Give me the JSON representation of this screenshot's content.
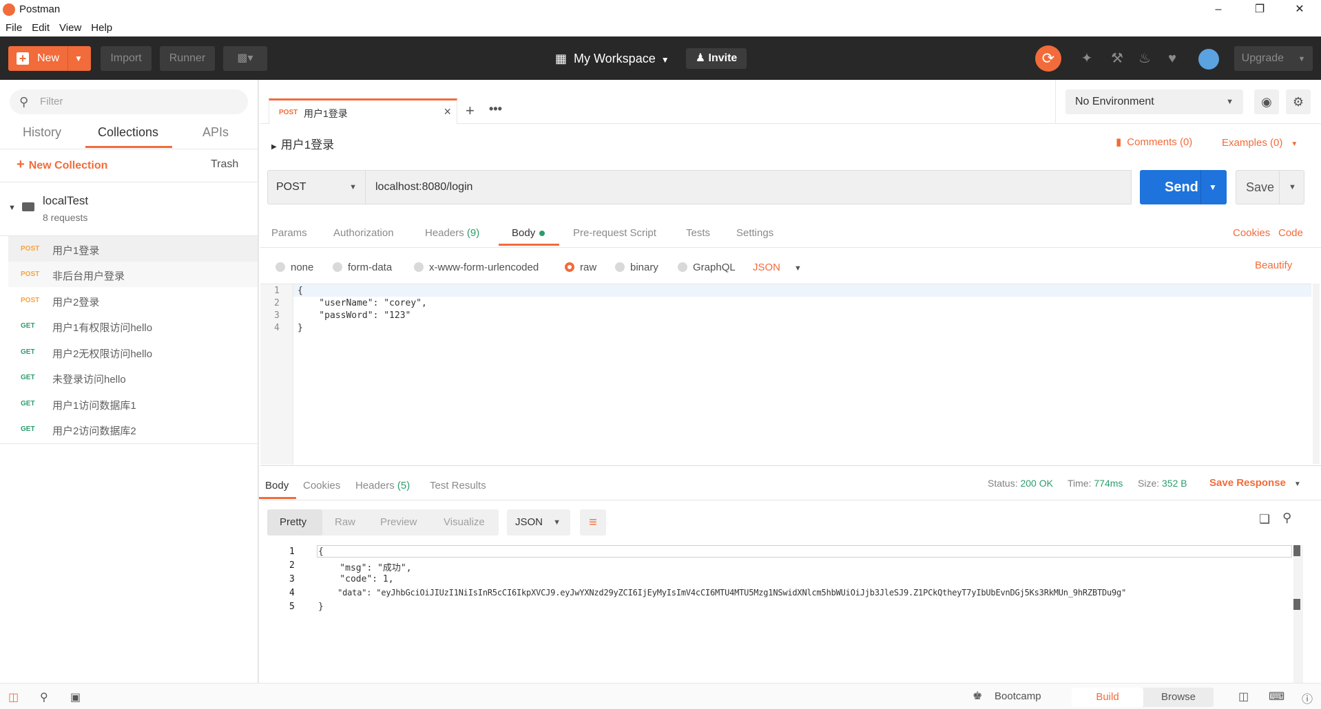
{
  "window": {
    "title": "Postman"
  },
  "menu": [
    "File",
    "Edit",
    "View",
    "Help"
  ],
  "header": {
    "new_label": "New",
    "import_label": "Import",
    "runner_label": "Runner",
    "workspace_label": "My Workspace",
    "invite_label": "Invite",
    "upgrade_label": "Upgrade"
  },
  "sidebar": {
    "filter_placeholder": "Filter",
    "tabs": [
      "History",
      "Collections",
      "APIs"
    ],
    "active_tab": "Collections",
    "new_collection_label": "New Collection",
    "trash_label": "Trash",
    "collection": {
      "name": "localTest",
      "count": "8 requests"
    },
    "requests": [
      {
        "method": "POST",
        "name": "用户1登录"
      },
      {
        "method": "POST",
        "name": "非后台用户登录"
      },
      {
        "method": "POST",
        "name": "用户2登录"
      },
      {
        "method": "GET",
        "name": "用户1有权限访问hello"
      },
      {
        "method": "GET",
        "name": "用户2无权限访问hello"
      },
      {
        "method": "GET",
        "name": "未登录访问hello"
      },
      {
        "method": "GET",
        "name": "用户1访问数据库1"
      },
      {
        "method": "GET",
        "name": "用户2访问数据库2"
      }
    ]
  },
  "tab": {
    "method": "POST",
    "name": "用户1登录"
  },
  "environment": {
    "selected": "No Environment"
  },
  "request": {
    "breadcrumb": "用户1登录",
    "comments_label": "Comments (0)",
    "examples_label": "Examples (0)",
    "method": "POST",
    "url": "localhost:8080/login",
    "send_label": "Send",
    "save_label": "Save",
    "tabs": {
      "params": "Params",
      "authorization": "Authorization",
      "headers": "Headers",
      "headers_count": "(9)",
      "body": "Body",
      "prerequest": "Pre-request Script",
      "tests": "Tests",
      "settings": "Settings"
    },
    "cookies_label": "Cookies",
    "code_label": "Code",
    "body_types": [
      "none",
      "form-data",
      "x-www-form-urlencoded",
      "raw",
      "binary",
      "GraphQL"
    ],
    "selected_body_type": "raw",
    "raw_format": "JSON",
    "beautify_label": "Beautify",
    "body_lines": [
      "{",
      "    \"userName\": \"corey\",",
      "    \"passWord\": \"123\"",
      "}"
    ]
  },
  "response": {
    "tabs": {
      "body": "Body",
      "cookies": "Cookies",
      "headers": "Headers",
      "headers_count": "(5)",
      "tests": "Test Results"
    },
    "status_label": "Status:",
    "status_value": "200 OK",
    "time_label": "Time:",
    "time_value": "774ms",
    "size_label": "Size:",
    "size_value": "352 B",
    "save_response_label": "Save Response",
    "view_modes": [
      "Pretty",
      "Raw",
      "Preview",
      "Visualize"
    ],
    "active_view": "Pretty",
    "format": "JSON",
    "line_numbers": [
      "1",
      "2",
      "3",
      "4",
      "5"
    ],
    "body_lines": [
      "{",
      "    \"msg\": \"成功\",",
      "    \"code\": 1,",
      "    \"data\": \"eyJhbGciOiJIUzI1NiIsInR5cCI6IkpXVCJ9.eyJwYXNzd29yZCI6IjEyMyIsImV4cCI6MTU4MTU5Mzg1NSwidXNlcm5hbWUiOiJjb3JleSJ9.Z1PCkQtheyT7yIbUbEvnDGj5Ks3RkMUn_9hRZBTDu9g\"",
      "}"
    ]
  },
  "statusbar": {
    "bootcamp_label": "Bootcamp",
    "build_label": "Build",
    "browse_label": "Browse"
  },
  "colors": {
    "accent": "#f26b3a",
    "send": "#1e73dc",
    "success": "#2a9d6a",
    "header_bg": "#282828"
  }
}
